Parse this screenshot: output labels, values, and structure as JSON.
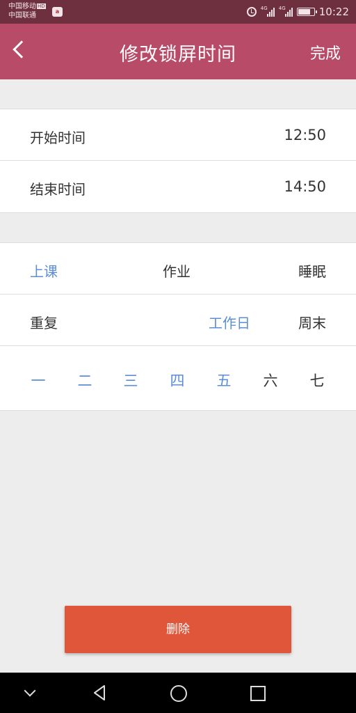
{
  "status_bar": {
    "carrier_1": "中国移动",
    "hd_badge": "HD",
    "carrier_2": "中国联通",
    "notification_app": "a",
    "network_tag_1": "4G",
    "network_tag_2": "4G",
    "time": "10:22",
    "battery_level": 0.8
  },
  "header": {
    "title": "修改锁屏时间",
    "done_label": "完成"
  },
  "time_settings": {
    "start_label": "开始时间",
    "start_value": "12:50",
    "end_label": "结束时间",
    "end_value": "14:50"
  },
  "mode": {
    "options": [
      "上课",
      "作业",
      "睡眠"
    ],
    "selected": "上课"
  },
  "repeat": {
    "label": "重复",
    "options": [
      "工作日",
      "周末"
    ],
    "selected": "工作日"
  },
  "days": [
    {
      "label": "一",
      "selected": true
    },
    {
      "label": "二",
      "selected": true
    },
    {
      "label": "三",
      "selected": true
    },
    {
      "label": "四",
      "selected": true
    },
    {
      "label": "五",
      "selected": true
    },
    {
      "label": "六",
      "selected": false
    },
    {
      "label": "七",
      "selected": false
    }
  ],
  "delete_label": "删除",
  "colors": {
    "status_bar": "#6e2f3e",
    "nav_bar": "#b84b67",
    "accent_blue": "#5b8ed6",
    "delete_button": "#e0563a"
  }
}
